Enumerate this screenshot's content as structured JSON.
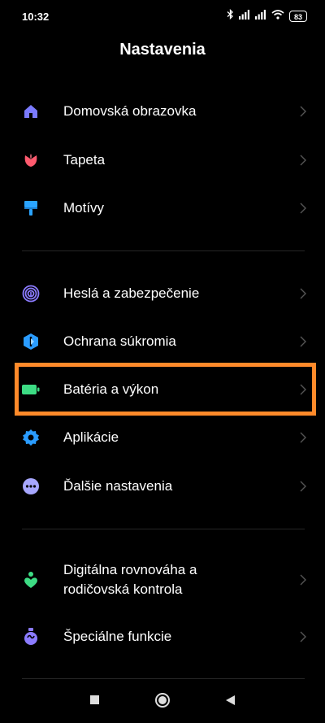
{
  "status_bar": {
    "time": "10:32",
    "battery_level": "83",
    "icons": [
      "bluetooth-icon",
      "signal-icon",
      "signal-icon",
      "wifi-icon",
      "battery-icon"
    ]
  },
  "page": {
    "title": "Nastavenia"
  },
  "groups": [
    {
      "items": [
        {
          "label": "Domovská obrazovka",
          "icon": "home-icon",
          "color": "#7b7bff"
        },
        {
          "label": "Tapeta",
          "icon": "tulip-icon",
          "color": "#ff5a6e"
        },
        {
          "label": "Motívy",
          "icon": "paint-brush-icon",
          "color": "#2aa4ff"
        }
      ]
    },
    {
      "items": [
        {
          "label": "Heslá a zabezpečenie",
          "icon": "fingerprint-icon",
          "color": "#8b7bff"
        },
        {
          "label": "Ochrana súkromia",
          "icon": "shield-icon",
          "color": "#2a9cff"
        },
        {
          "label": "Batéria a výkon",
          "icon": "battery-icon",
          "color": "#3ddc84"
        },
        {
          "label": "Aplikácie",
          "icon": "gear-icon",
          "color": "#2a9cff"
        },
        {
          "label": "Ďalšie nastavenia",
          "icon": "more-dots-icon",
          "color": "#a7a7ff"
        }
      ]
    },
    {
      "items": [
        {
          "label_line1": "Digitálna rovnováha a",
          "label_line2": "rodičovská kontrola",
          "icon": "heart-person-icon",
          "color": "#3ddc84"
        },
        {
          "label": "Špeciálne funkcie",
          "icon": "special-functions-icon",
          "color": "#8b7bff"
        }
      ]
    }
  ],
  "highlight": {
    "target": "Batéria a výkon",
    "color": "#ff8a2a"
  },
  "nav_bar": {
    "buttons": [
      "recents-square-icon",
      "home-circle-icon",
      "back-triangle-icon"
    ]
  }
}
